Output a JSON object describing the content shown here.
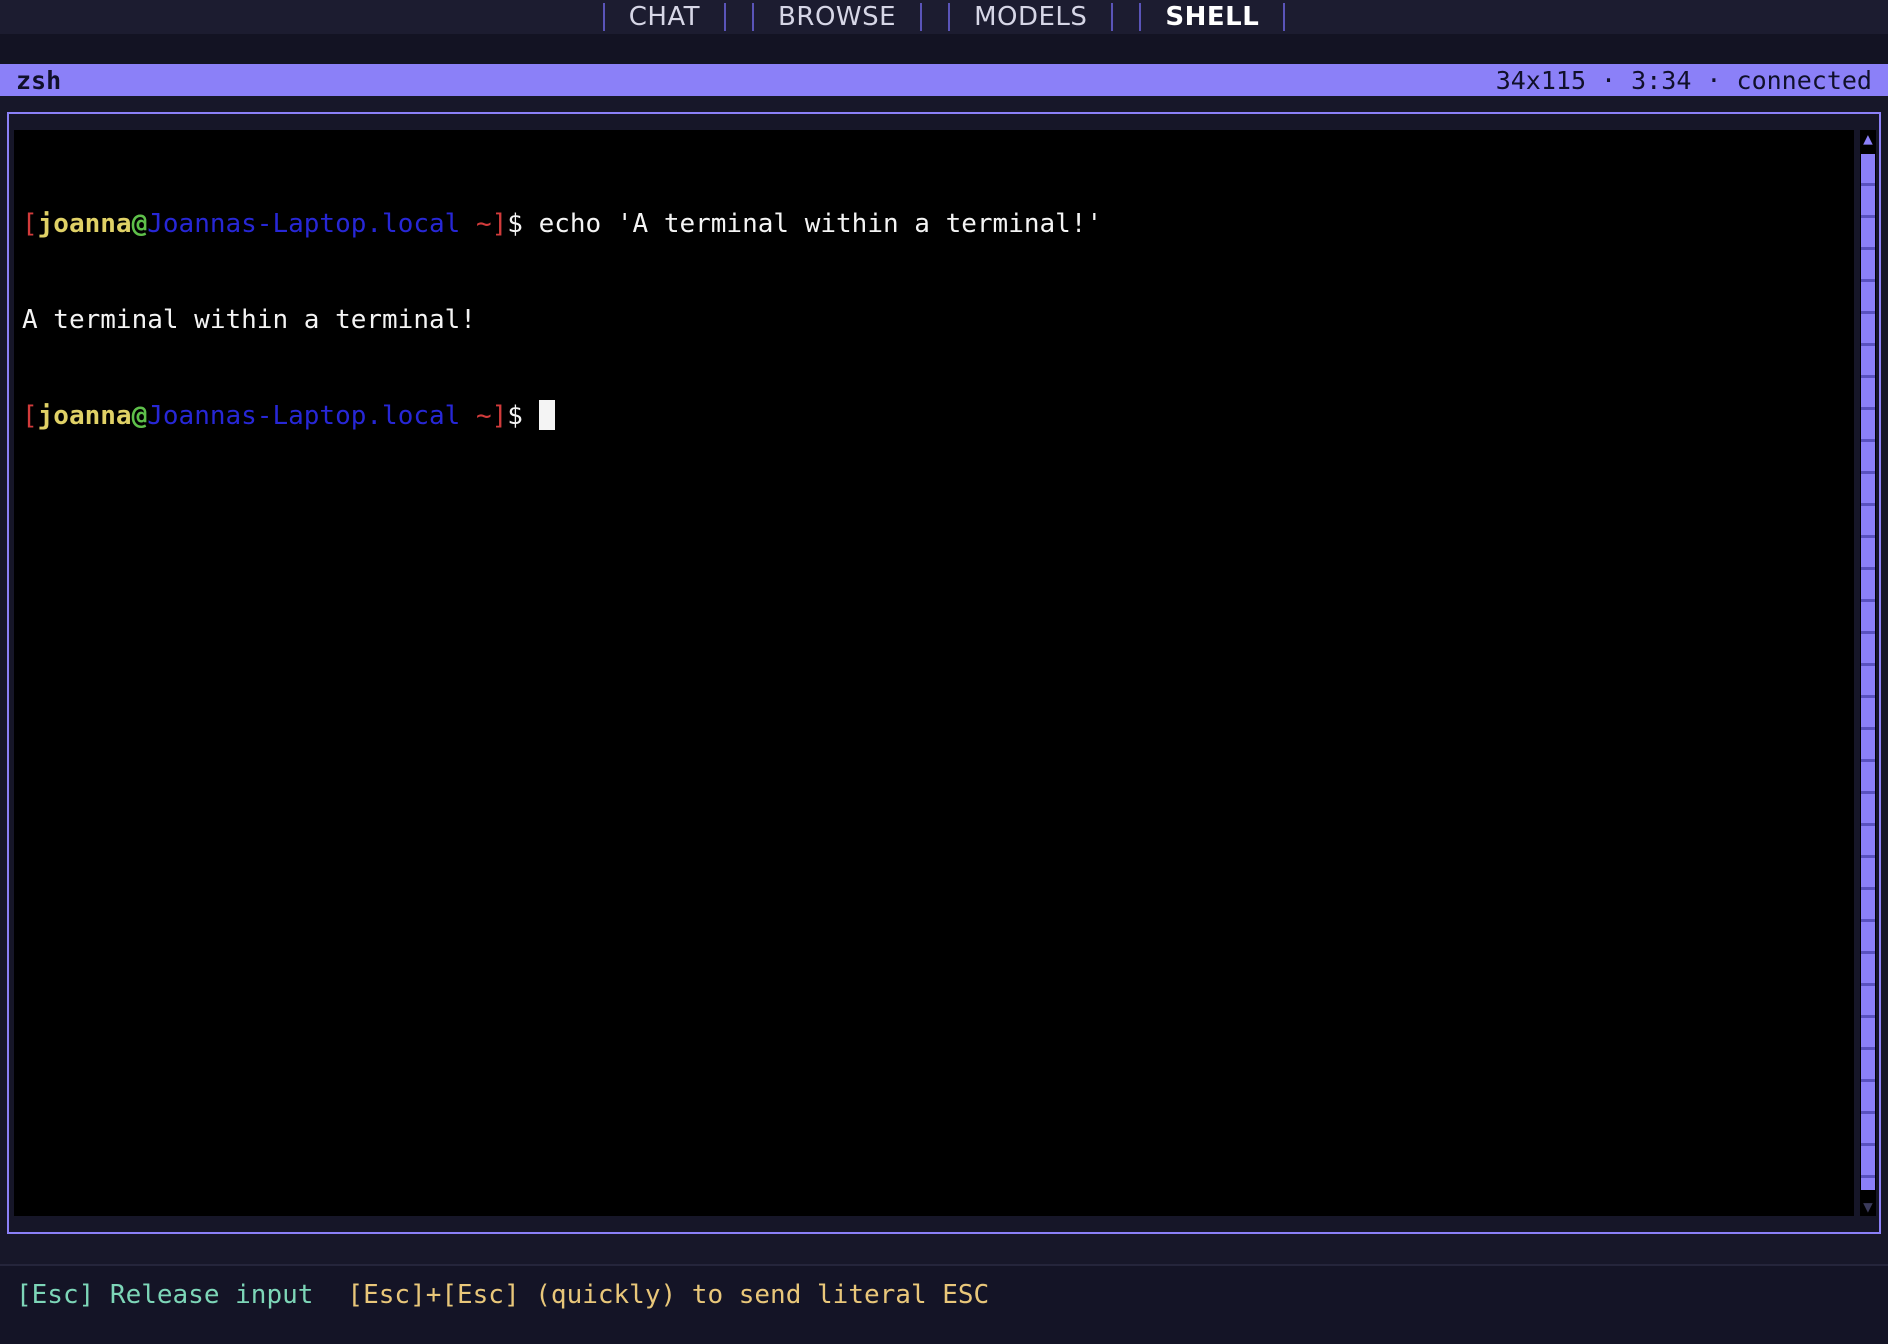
{
  "tabs": [
    {
      "label": "CHAT",
      "active": false
    },
    {
      "label": "BROWSE",
      "active": false
    },
    {
      "label": "MODELS",
      "active": false
    },
    {
      "label": "SHELL",
      "active": true
    }
  ],
  "titlebar": {
    "title": "zsh",
    "status": "34x115 · 3:34 · connected"
  },
  "terminal": {
    "prompt": {
      "open_bracket": "[",
      "user": "joanna",
      "at": "@",
      "host": "Joannas-Laptop.local",
      "cwd": " ~",
      "close_bracket": "]",
      "symbol": "$ "
    },
    "command": "echo 'A terminal within a terminal!'",
    "output": "A terminal within a terminal!"
  },
  "footer": {
    "release_hint": "[Esc] Release input",
    "literal_hint": "[Esc]+[Esc] (quickly) to send literal ESC"
  },
  "colors": {
    "accent": "#8b80f8",
    "bracket": "#d23b3b",
    "user": "#e0d166",
    "at": "#5ec04a",
    "host": "#2727d6"
  }
}
